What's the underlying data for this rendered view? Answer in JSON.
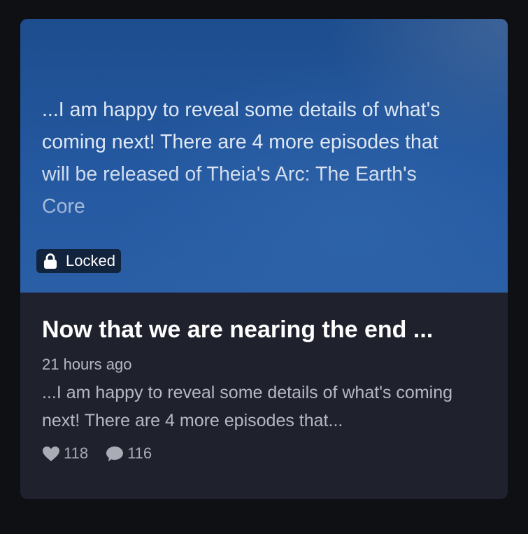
{
  "post": {
    "preview_text": "...I am happy to reveal some details of what's coming next! There are 4 more episodes that will be released of Theia's Arc: The Earth's Core",
    "locked_label": "Locked",
    "title": "Now that we are nearing the end ...",
    "timestamp": "21 hours ago",
    "excerpt": "...I am happy to reveal some details of what's coming next! There are 4 more episodes that...",
    "likes": "118",
    "comments": "116"
  },
  "icons": {
    "lock": "lock-icon",
    "like": "heart-icon",
    "comment": "comment-icon"
  },
  "colors": {
    "page_bg": "#0f1014",
    "card_bg": "#1f222d",
    "preview_blue": "#2458a0",
    "badge_bg": "#12233d"
  }
}
